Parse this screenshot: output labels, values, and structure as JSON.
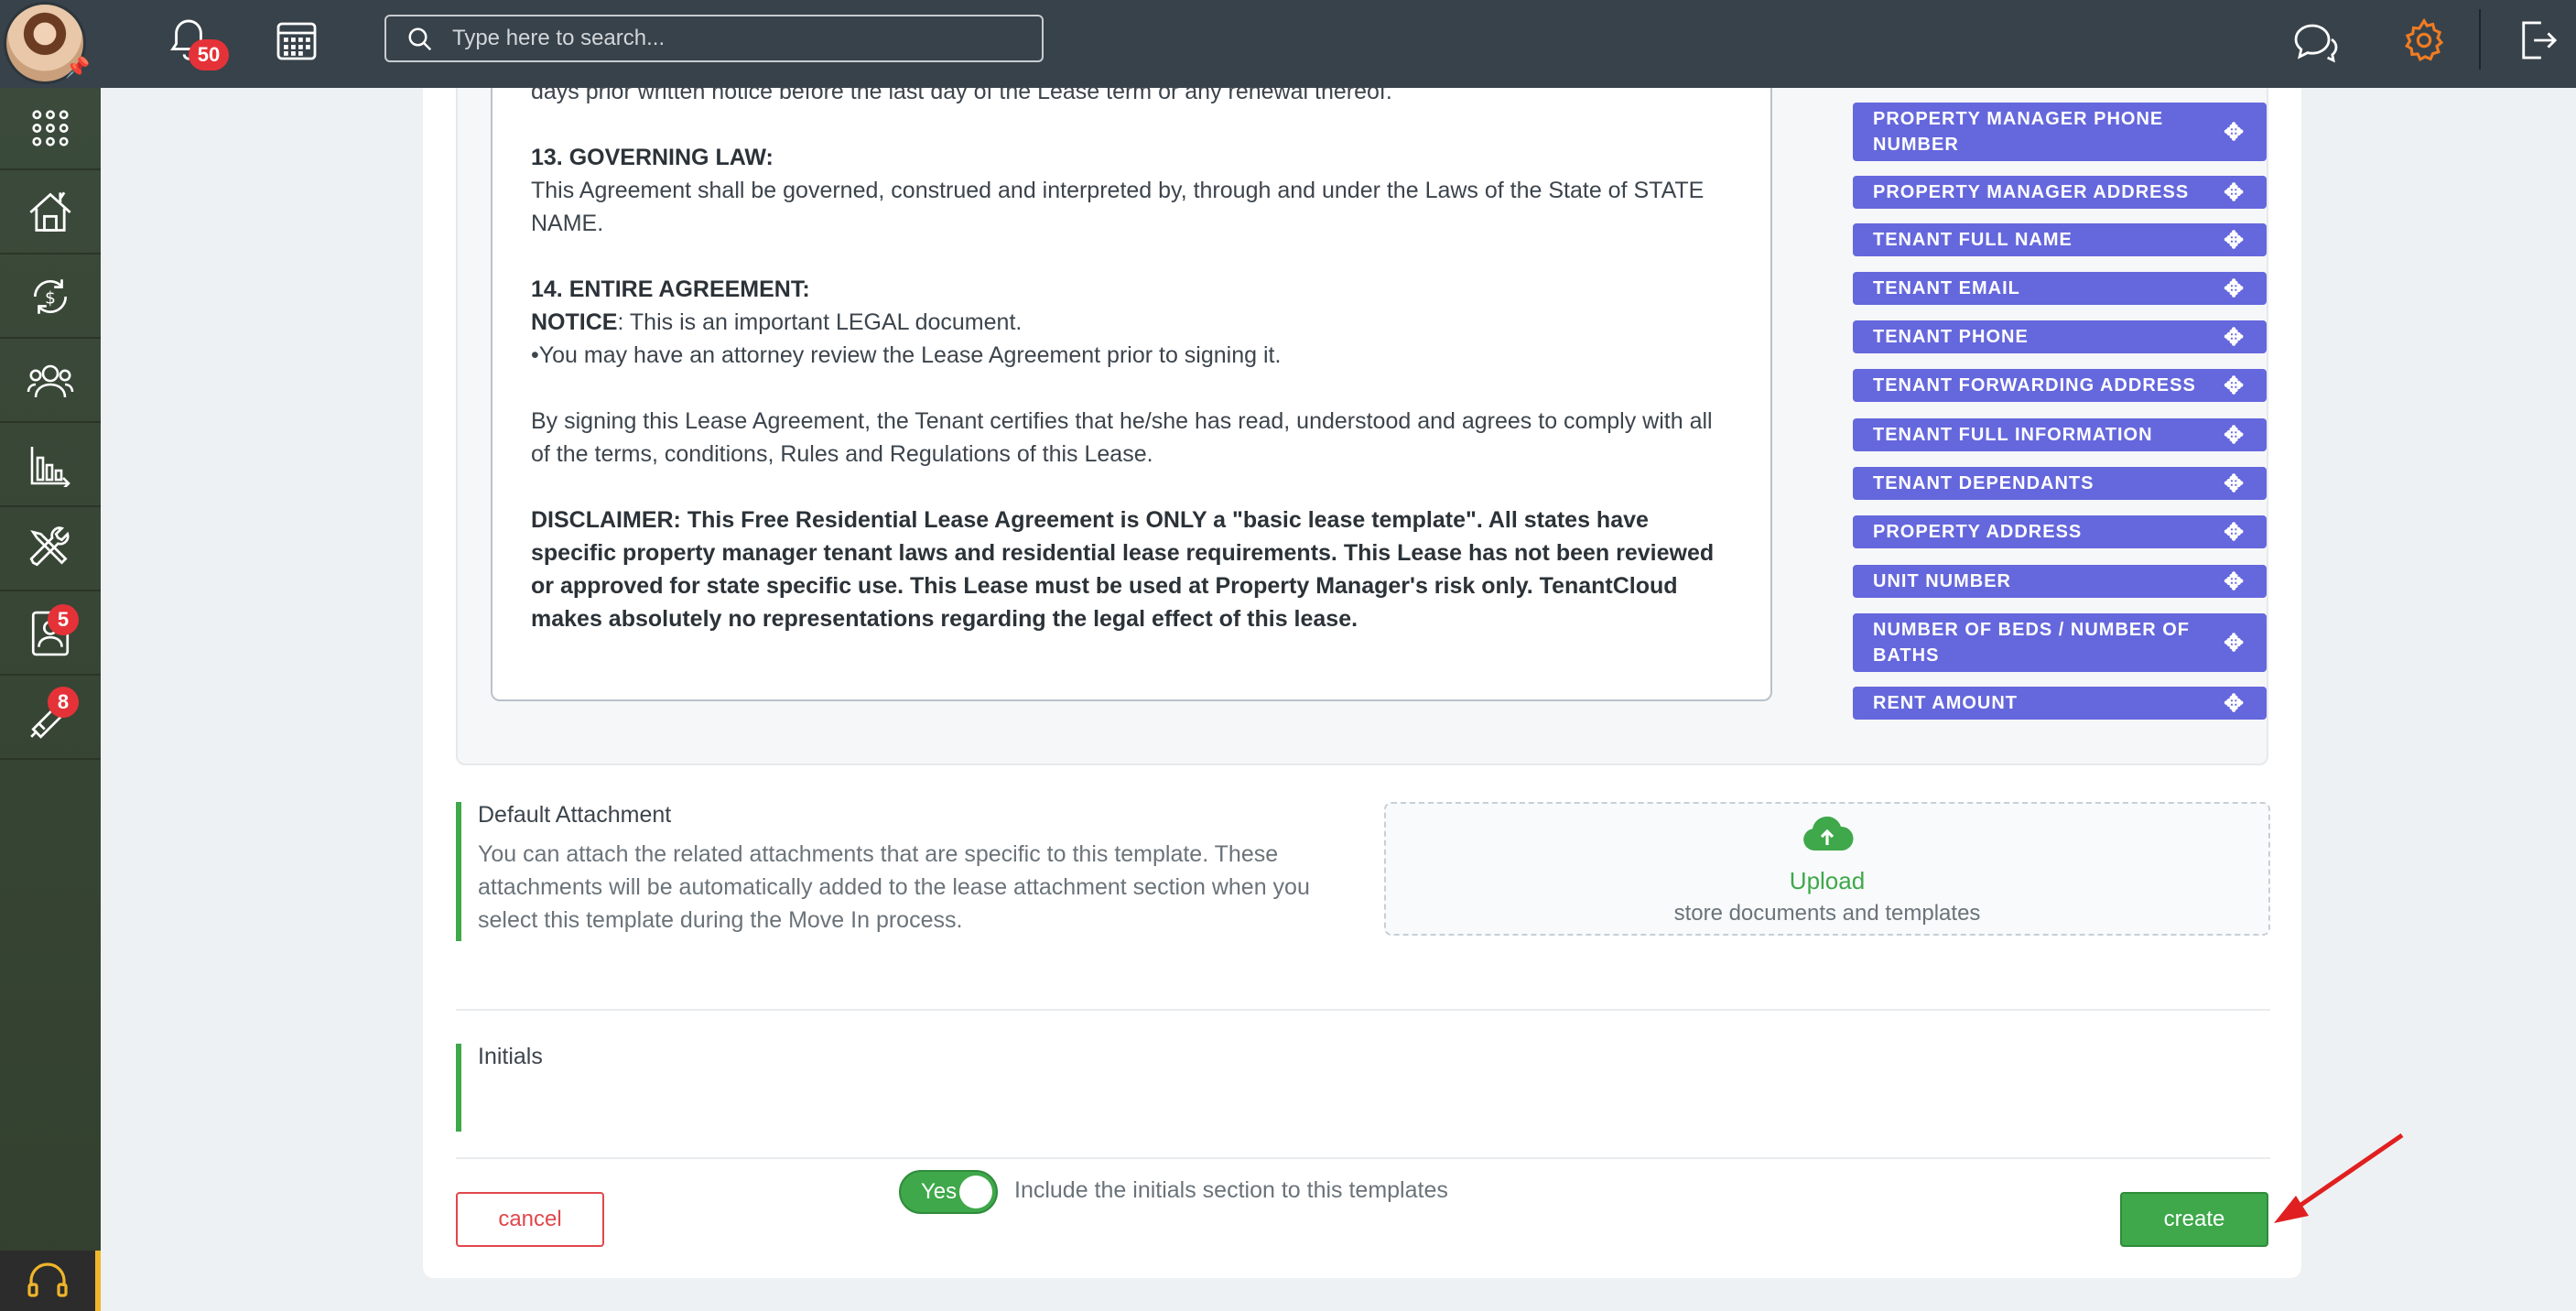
{
  "header": {
    "notifications_count": "50",
    "search_placeholder": "Type here to search..."
  },
  "sidebar": {
    "items": [
      {
        "name": "apps",
        "icon": "grid-icon"
      },
      {
        "name": "properties",
        "icon": "house-icon"
      },
      {
        "name": "accounting",
        "icon": "money-cycle-icon"
      },
      {
        "name": "contacts",
        "icon": "people-icon"
      },
      {
        "name": "reports",
        "icon": "bar-chart-icon"
      },
      {
        "name": "maintenance",
        "icon": "tools-icon"
      },
      {
        "name": "applications",
        "icon": "tenant-card-icon",
        "badge": "5"
      },
      {
        "name": "listings",
        "icon": "megaphone-icon",
        "badge": "8"
      }
    ]
  },
  "document": {
    "cut_line": "days prior written notice before the last day of the Lease term or any renewal thereof.",
    "s13_title": "13. GOVERNING LAW:",
    "s13_body": "This Agreement shall be governed, construed and interpreted by, through and under the Laws of the State of STATE NAME.",
    "s14_title": "14. ENTIRE AGREEMENT:",
    "notice_label": "NOTICE",
    "notice_text": ": This is an important LEGAL document.",
    "attorney_line": "•You may have an attorney review the Lease Agreement prior to signing it.",
    "certify": "By signing this Lease Agreement, the Tenant certifies that he/she has read, understood and agrees to comply with all of the terms, conditions, Rules and Regulations of this Lease.",
    "disclaimer": "DISCLAIMER: This Free Residential Lease Agreement is ONLY a \"basic lease template\". All states have specific property manager tenant laws and residential lease requirements. This Lease has not been reviewed or approved for state specific use. This Lease must be used at Property Manager's risk only. TenantCloud makes absolutely no representations regarding the legal effect of this lease."
  },
  "tags": [
    "PROPERTY MANAGER PHONE NUMBER",
    "PROPERTY MANAGER ADDRESS",
    "TENANT FULL NAME",
    "TENANT EMAIL",
    "TENANT PHONE",
    "TENANT FORWARDING ADDRESS",
    "TENANT FULL INFORMATION",
    "TENANT DEPENDANTS",
    "PROPERTY ADDRESS",
    "UNIT NUMBER",
    "NUMBER OF BEDS / NUMBER OF BATHS",
    "RENT AMOUNT"
  ],
  "attachment": {
    "title": "Default Attachment",
    "description": "You can attach the related attachments that are specific to this template. These attachments will be automatically added to the lease attachment section when you select this template during the Move In process.",
    "upload_title": "Upload",
    "upload_subtitle": "store documents and templates"
  },
  "initials": {
    "title": "Initials",
    "toggle_label": "Yes",
    "toggle_on": true,
    "description": "Include the initials section to this templates"
  },
  "actions": {
    "cancel": "cancel",
    "create": "create"
  },
  "colors": {
    "topbar": "#38424a",
    "tag": "#6567dd",
    "accent_green": "#3ea84a",
    "danger": "#e0474c",
    "settings_icon": "#f07c24"
  }
}
